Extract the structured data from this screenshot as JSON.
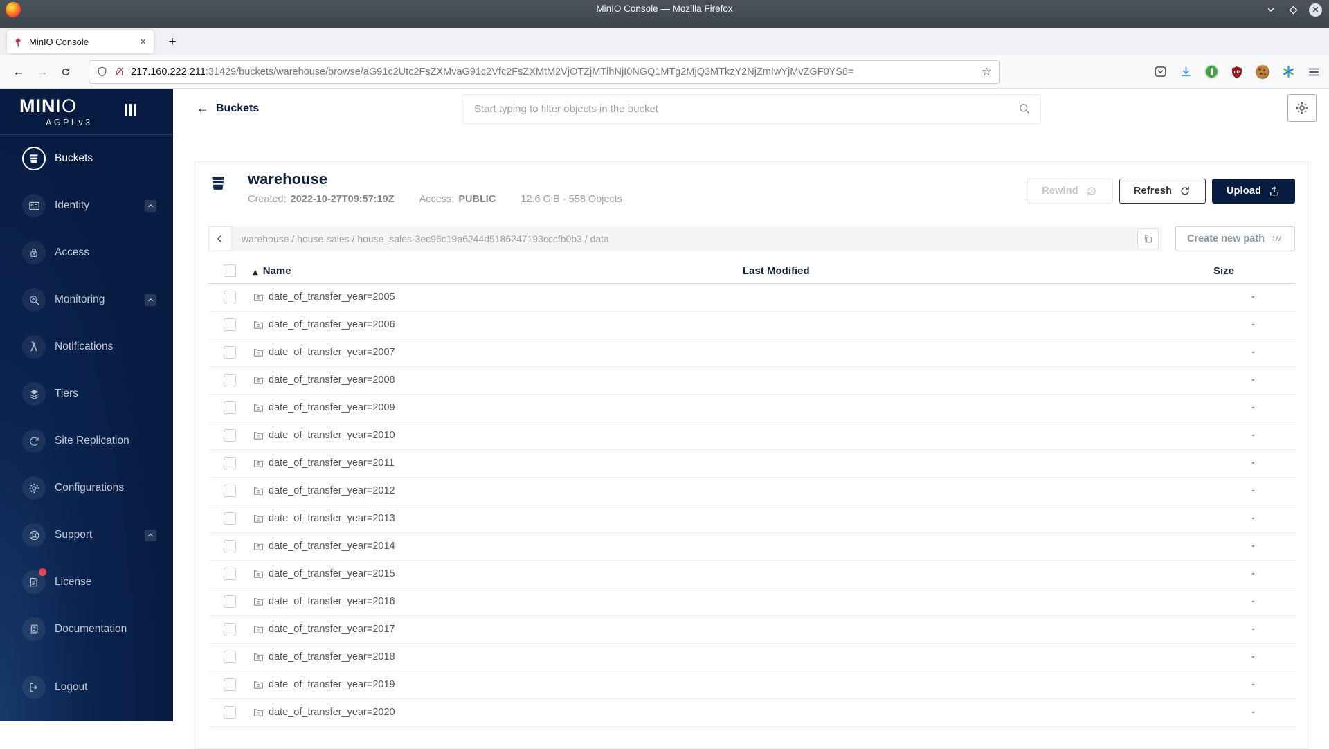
{
  "browser": {
    "window_title": "MinIO Console — Mozilla Firefox",
    "tab_title": "MinIO Console",
    "close_tab_glyph": "×",
    "new_tab_glyph": "+",
    "back_glyph": "←",
    "forward_glyph": "→",
    "star_glyph": "☆",
    "url_host": "217.160.222.211",
    "url_rest": ":31429/buckets/warehouse/browse/aG91c2Utc2FsZXMvaG91c2Vfc2FsZXMtM2VjOTZjMTlhNjI0NGQ1MTg2MjQ3MTkzY2NjZmIwYjMvZGF0YS8="
  },
  "sidebar": {
    "logo_bold": "MIN",
    "logo_light": "IO",
    "license_edition": "AGPLv3",
    "items": [
      {
        "label": "Buckets",
        "icon": "bucket-icon",
        "active": true
      },
      {
        "label": "Identity",
        "icon": "identity-icon",
        "expandable": true
      },
      {
        "label": "Access",
        "icon": "lock-icon"
      },
      {
        "label": "Monitoring",
        "icon": "monitoring-icon",
        "expandable": true
      },
      {
        "label": "Notifications",
        "icon": "lambda-icon"
      },
      {
        "label": "Tiers",
        "icon": "tiers-icon"
      },
      {
        "label": "Site Replication",
        "icon": "replication-icon"
      },
      {
        "label": "Configurations",
        "icon": "gear-icon"
      },
      {
        "label": "Support",
        "icon": "support-icon",
        "expandable": true
      },
      {
        "label": "License",
        "icon": "license-icon",
        "badge": true
      },
      {
        "label": "Documentation",
        "icon": "docs-icon"
      },
      {
        "label": "Logout",
        "icon": "logout-icon"
      }
    ]
  },
  "header": {
    "back_label": "Buckets",
    "back_glyph": "←",
    "search_placeholder": "Start typing to filter objects in the bucket"
  },
  "bucket": {
    "name": "warehouse",
    "created_label": "Created:",
    "created_value": "2022-10-27T09:57:19Z",
    "access_label": "Access:",
    "access_value": "PUBLIC",
    "summary": "12.6 GiB - 558 Objects",
    "rewind_label": "Rewind",
    "refresh_label": "Refresh",
    "upload_label": "Upload"
  },
  "breadcrumb": {
    "segments": [
      "warehouse",
      "house-sales",
      "house_sales-3ec96c19a6244d5186247193cccfb0b3",
      "data"
    ],
    "separator": " / ",
    "create_path_label": "Create new path"
  },
  "table": {
    "columns": {
      "name": "Name",
      "last_modified": "Last Modified",
      "size": "Size"
    },
    "sort_glyph": "▲",
    "rows": [
      {
        "name": "date_of_transfer_year=2005",
        "last_modified": "",
        "size": "-"
      },
      {
        "name": "date_of_transfer_year=2006",
        "last_modified": "",
        "size": "-"
      },
      {
        "name": "date_of_transfer_year=2007",
        "last_modified": "",
        "size": "-"
      },
      {
        "name": "date_of_transfer_year=2008",
        "last_modified": "",
        "size": "-"
      },
      {
        "name": "date_of_transfer_year=2009",
        "last_modified": "",
        "size": "-"
      },
      {
        "name": "date_of_transfer_year=2010",
        "last_modified": "",
        "size": "-"
      },
      {
        "name": "date_of_transfer_year=2011",
        "last_modified": "",
        "size": "-"
      },
      {
        "name": "date_of_transfer_year=2012",
        "last_modified": "",
        "size": "-"
      },
      {
        "name": "date_of_transfer_year=2013",
        "last_modified": "",
        "size": "-"
      },
      {
        "name": "date_of_transfer_year=2014",
        "last_modified": "",
        "size": "-"
      },
      {
        "name": "date_of_transfer_year=2015",
        "last_modified": "",
        "size": "-"
      },
      {
        "name": "date_of_transfer_year=2016",
        "last_modified": "",
        "size": "-"
      },
      {
        "name": "date_of_transfer_year=2017",
        "last_modified": "",
        "size": "-"
      },
      {
        "name": "date_of_transfer_year=2018",
        "last_modified": "",
        "size": "-"
      },
      {
        "name": "date_of_transfer_year=2019",
        "last_modified": "",
        "size": "-"
      },
      {
        "name": "date_of_transfer_year=2020",
        "last_modified": "",
        "size": "-"
      }
    ]
  },
  "colors": {
    "navy": "#081C42",
    "badge_red": "#E4464D",
    "sidebar_text": "#C2CAD6"
  }
}
